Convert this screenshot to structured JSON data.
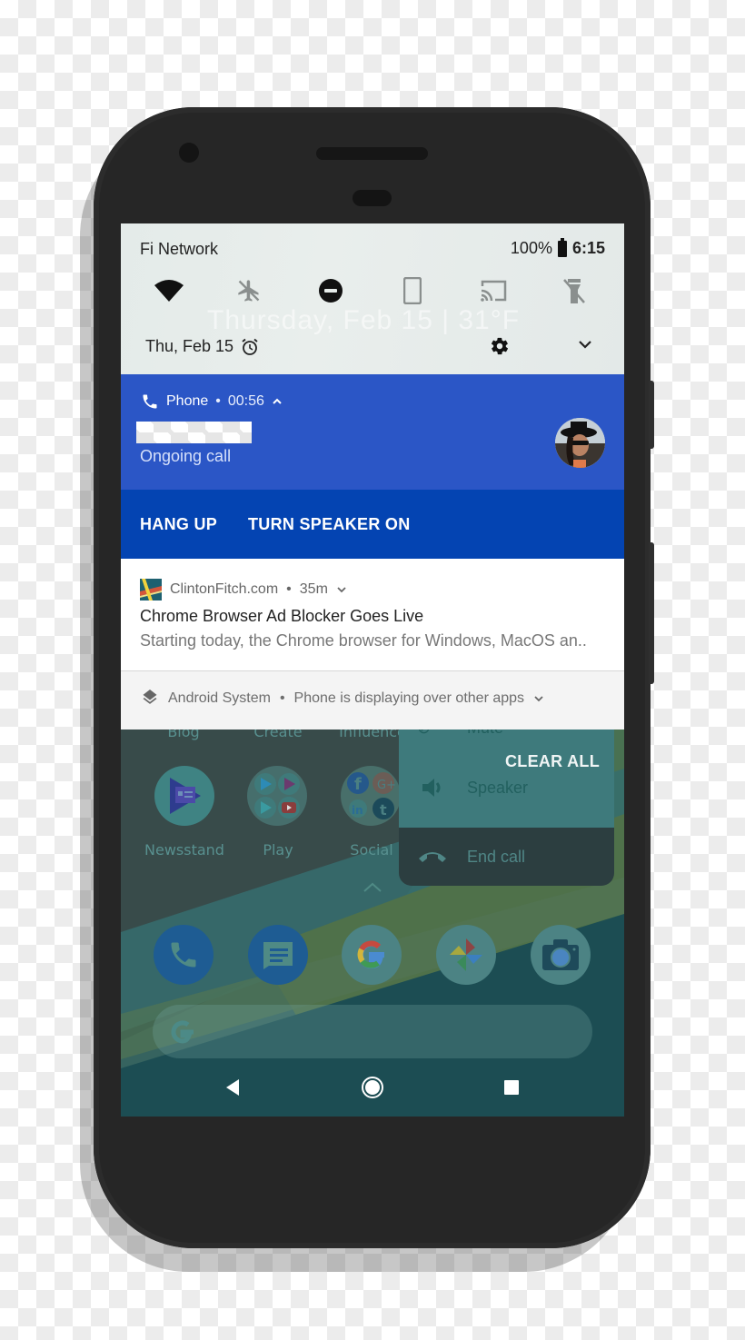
{
  "quick_settings": {
    "carrier": "Fi Network",
    "battery_percent": "100%",
    "time": "6:15",
    "date": "Thu, Feb 15",
    "ghost_text": "Thursday, Feb 15 | 31°F",
    "tiles": [
      {
        "name": "wifi",
        "state": "on"
      },
      {
        "name": "airplane-mode",
        "state": "off"
      },
      {
        "name": "do-not-disturb",
        "state": "on"
      },
      {
        "name": "auto-rotate",
        "state": "off"
      },
      {
        "name": "cast",
        "state": "off"
      },
      {
        "name": "flashlight",
        "state": "off"
      }
    ]
  },
  "call_notification": {
    "app": "Phone",
    "separator": "•",
    "duration": "00:56",
    "status": "Ongoing call",
    "actions": {
      "hang_up": "HANG UP",
      "speaker": "TURN SPEAKER ON"
    },
    "colors": {
      "header": "#2b56c6",
      "actions": "#0444b2"
    }
  },
  "article_notification": {
    "source": "ClintonFitch.com",
    "age": "35m",
    "title": "Chrome Browser Ad Blocker Goes Live",
    "body": "Starting today, the Chrome browser for Windows, MacOS an.."
  },
  "system_notification": {
    "source": "Android System",
    "message": "Phone is displaying over other apps"
  },
  "clear_all": "CLEAR ALL",
  "home": {
    "partial_labels": [
      "Blog",
      "Create",
      "Influence"
    ],
    "apps": [
      {
        "label": "Newsstand"
      },
      {
        "label": "Play"
      },
      {
        "label": "Social"
      }
    ],
    "call_menu": {
      "mute": "Mute",
      "speaker": "Speaker",
      "end_call": "End call"
    },
    "dock": [
      "Phone",
      "Messages",
      "Google",
      "Photos",
      "Camera"
    ]
  }
}
